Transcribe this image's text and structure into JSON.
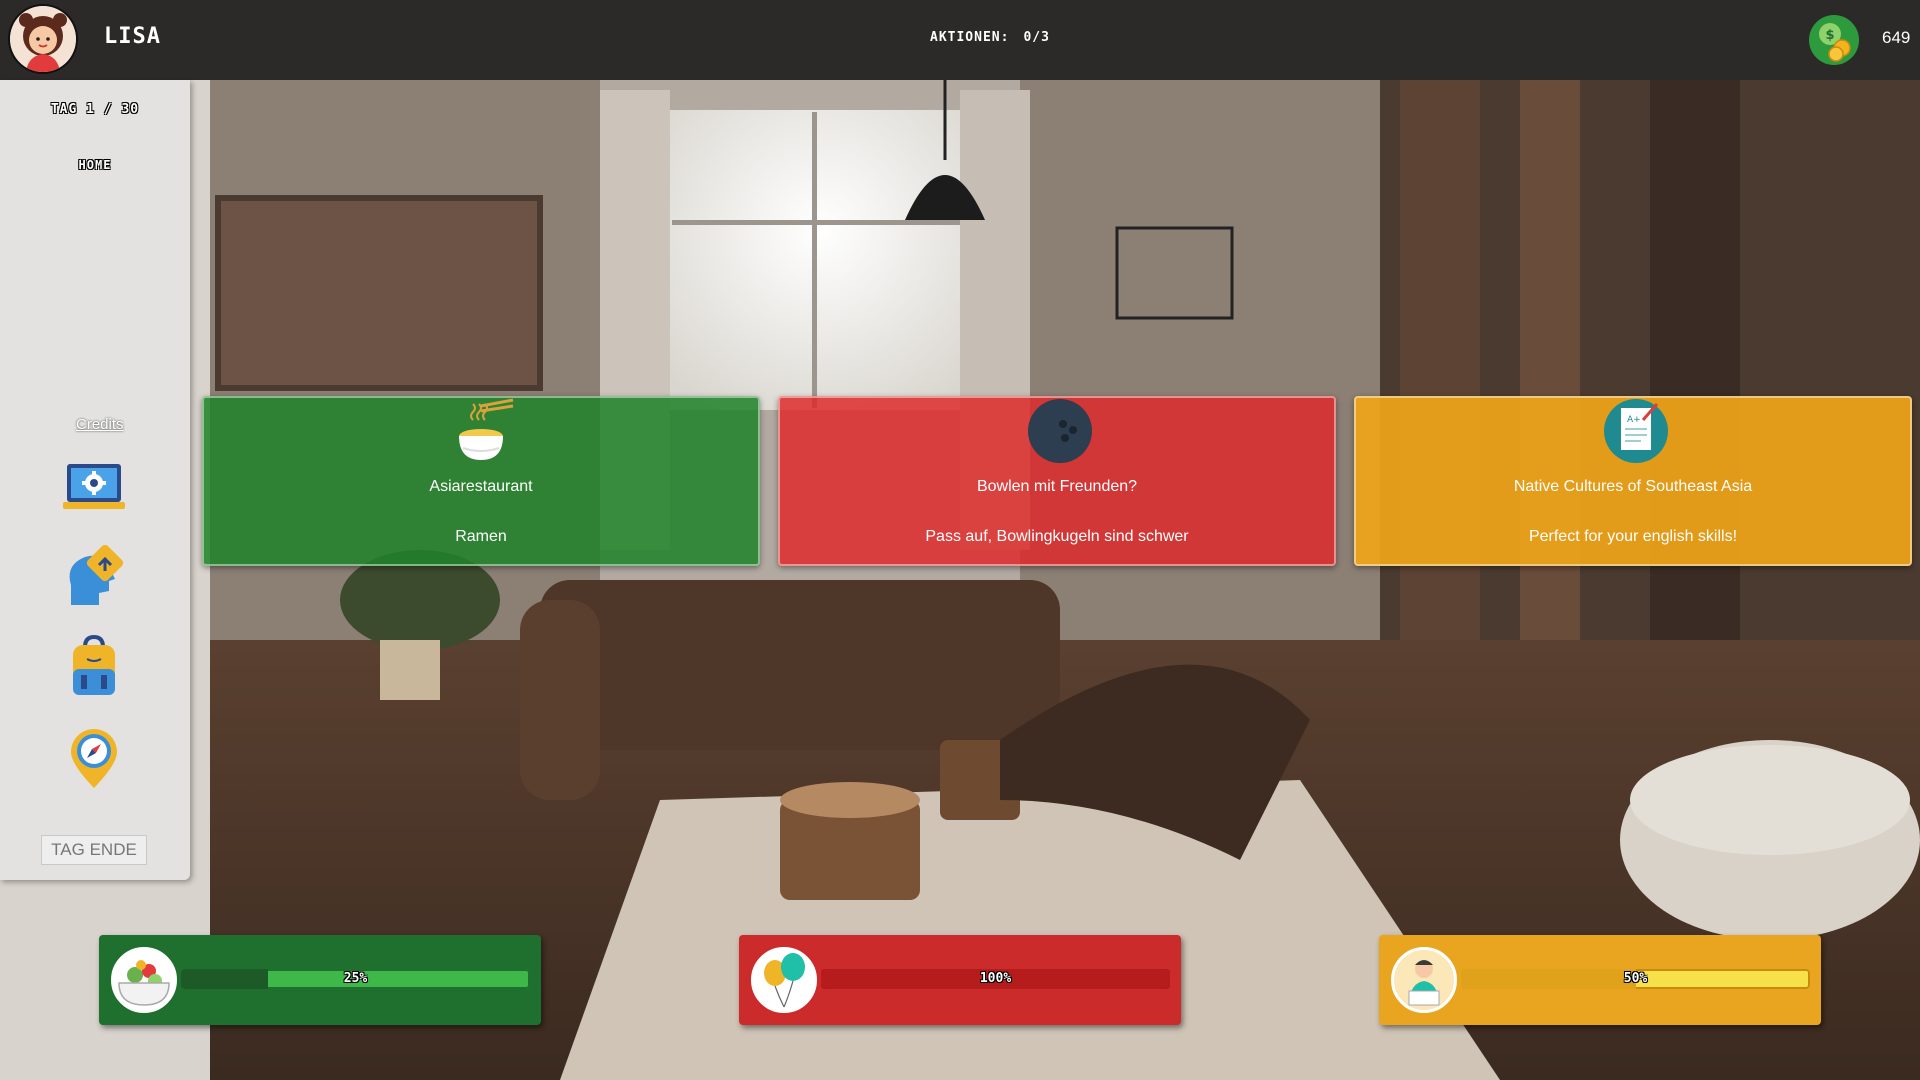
{
  "player": {
    "name": "LISA"
  },
  "topbar": {
    "actions_label": "AKTIONEN:",
    "actions_value": "0/3",
    "money": "649"
  },
  "sidebar": {
    "day": "TAG 1 / 30",
    "location": "HOME",
    "credits": "Credits",
    "icons": [
      "settings-laptop-icon",
      "skills-head-icon",
      "backpack-icon",
      "map-compass-icon"
    ],
    "end_day": "TAG ENDE"
  },
  "cards": [
    {
      "icon": "ramen-bowl-icon",
      "title": "Asiarestaurant",
      "desc": "Ramen",
      "color": "#1f822a"
    },
    {
      "icon": "bowling-ball-icon",
      "title": "Bowlen mit Freunden?",
      "desc": "Pass auf, Bowlingkugeln sind schwer",
      "color": "#de2a2a"
    },
    {
      "icon": "graded-paper-icon",
      "title": "Native Cultures of Southeast Asia",
      "desc": "Perfect for your english skills!",
      "color": "#f0a519"
    }
  ],
  "stats": [
    {
      "icon": "food-bowl-icon",
      "percent": 25,
      "label": "25%",
      "color": "#1f6f2e"
    },
    {
      "icon": "balloons-icon",
      "percent": 100,
      "label": "100%",
      "color": "#cc2b2b"
    },
    {
      "icon": "student-laptop-icon",
      "percent": 50,
      "label": "50%",
      "color": "#e9a51f"
    }
  ]
}
